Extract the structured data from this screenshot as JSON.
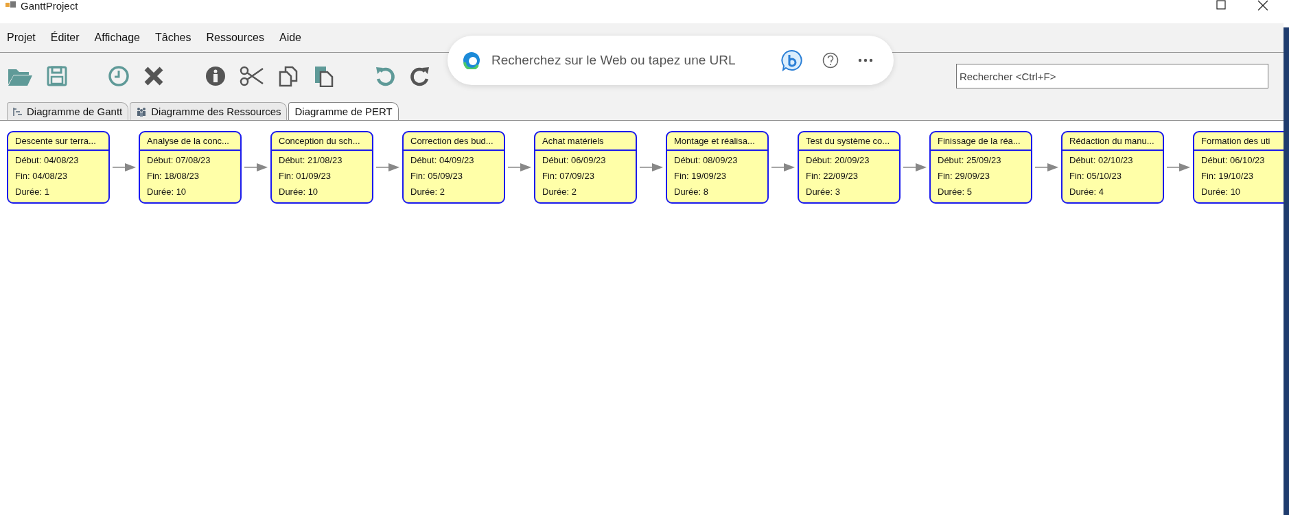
{
  "window": {
    "title": "GanttProject"
  },
  "menu": [
    "Projet",
    "Éditer",
    "Affichage",
    "Tâches",
    "Ressources",
    "Aide"
  ],
  "browser_popup": {
    "placeholder": "Recherchez sur le Web ou tapez une URL"
  },
  "search": {
    "placeholder": "Rechercher <Ctrl+F>"
  },
  "tabs": [
    {
      "label": "Diagramme de Gantt",
      "selected": false,
      "kind": "gantt"
    },
    {
      "label": "Diagramme des Ressources",
      "selected": false,
      "kind": "resources"
    },
    {
      "label": "Diagramme de PERT",
      "selected": true,
      "kind": "pert"
    }
  ],
  "pert_nodes": [
    {
      "title": "Descente sur terra...",
      "start": "Début: 04/08/23",
      "end": "Fin: 04/08/23",
      "duration": "Durée: 1"
    },
    {
      "title": "Analyse de la conc...",
      "start": "Début: 07/08/23",
      "end": "Fin: 18/08/23",
      "duration": "Durée: 10"
    },
    {
      "title": "Conception du sch...",
      "start": "Début: 21/08/23",
      "end": "Fin: 01/09/23",
      "duration": "Durée: 10"
    },
    {
      "title": "Correction des bud...",
      "start": "Début: 04/09/23",
      "end": "Fin: 05/09/23",
      "duration": "Durée: 2"
    },
    {
      "title": "Achat matériels",
      "start": "Début: 06/09/23",
      "end": "Fin: 07/09/23",
      "duration": "Durée: 2"
    },
    {
      "title": "Montage et réalisa...",
      "start": "Début: 08/09/23",
      "end": "Fin: 19/09/23",
      "duration": "Durée: 8"
    },
    {
      "title": "Test du système co...",
      "start": "Début: 20/09/23",
      "end": "Fin: 22/09/23",
      "duration": "Durée: 3"
    },
    {
      "title": "Finissage de la réa...",
      "start": "Début: 25/09/23",
      "end": "Fin: 29/09/23",
      "duration": "Durée: 5"
    },
    {
      "title": "Rédaction du manu...",
      "start": "Début: 02/10/23",
      "end": "Fin: 05/10/23",
      "duration": "Durée: 4"
    },
    {
      "title": "Formation des uti",
      "start": "Début: 06/10/23",
      "end": "Fin: 19/10/23",
      "duration": "Durée: 10"
    }
  ]
}
